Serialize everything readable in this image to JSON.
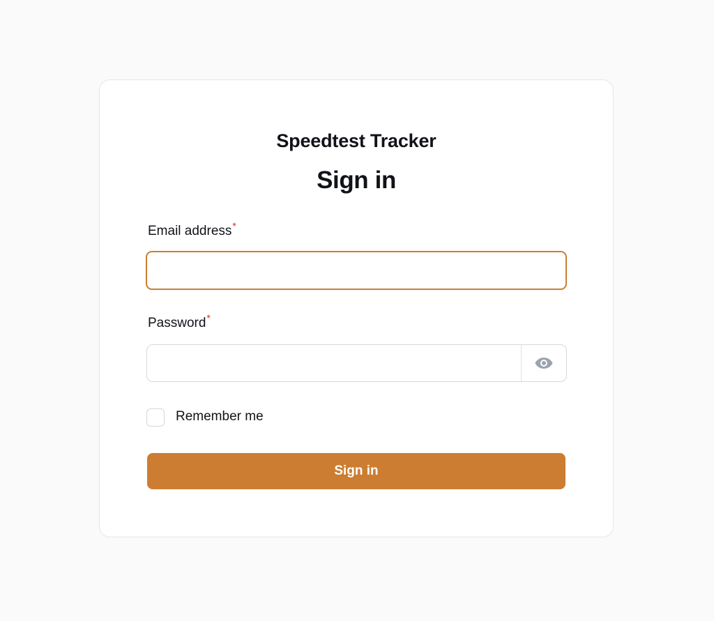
{
  "app": {
    "title": "Speedtest Tracker"
  },
  "form": {
    "heading": "Sign in",
    "email": {
      "label": "Email address",
      "required_mark": "*",
      "value": ""
    },
    "password": {
      "label": "Password",
      "required_mark": "*",
      "value": "",
      "reveal_icon": "eye-icon"
    },
    "remember": {
      "label": "Remember me",
      "checked": false
    },
    "submit_label": "Sign in"
  },
  "colors": {
    "accent": "#cc7d31",
    "required": "#dc2626",
    "background": "#fafafa"
  }
}
